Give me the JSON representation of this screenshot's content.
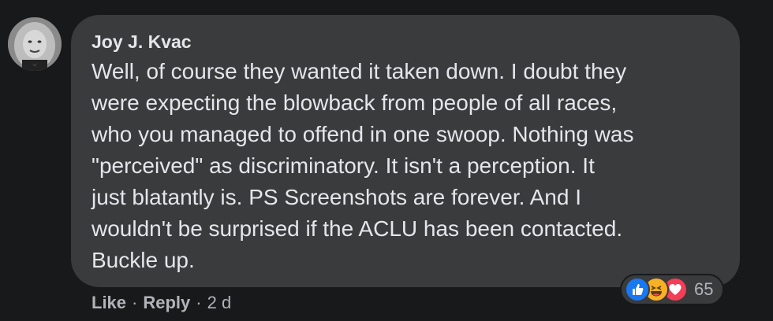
{
  "comment": {
    "author": "Joy J. Kvac",
    "lines": [
      "Well, of course they wanted it taken down. I doubt they",
      "were expecting the blowback from people of all races,",
      "who you managed to offend in one swoop. Nothing was",
      "\"perceived\" as discriminatory. It isn't a perception. It",
      "just blatantly is. PS Screenshots are forever. And I",
      "wouldn't be surprised if the ACLU has been contacted.",
      "Buckle up."
    ],
    "actions": {
      "like_label": "Like",
      "separator": "·",
      "reply_label": "Reply",
      "timestamp": "2 d"
    },
    "reactions": {
      "icons": [
        "like-icon",
        "haha-icon",
        "love-icon"
      ],
      "count": "65",
      "colors": {
        "like": "#1877f2",
        "haha": "#f7b125",
        "love": "#f33e58"
      }
    }
  },
  "colors": {
    "background": "#18191a",
    "bubble": "#3a3b3c",
    "text": "#e4e6eb",
    "secondary_text": "#b0b3b8"
  }
}
